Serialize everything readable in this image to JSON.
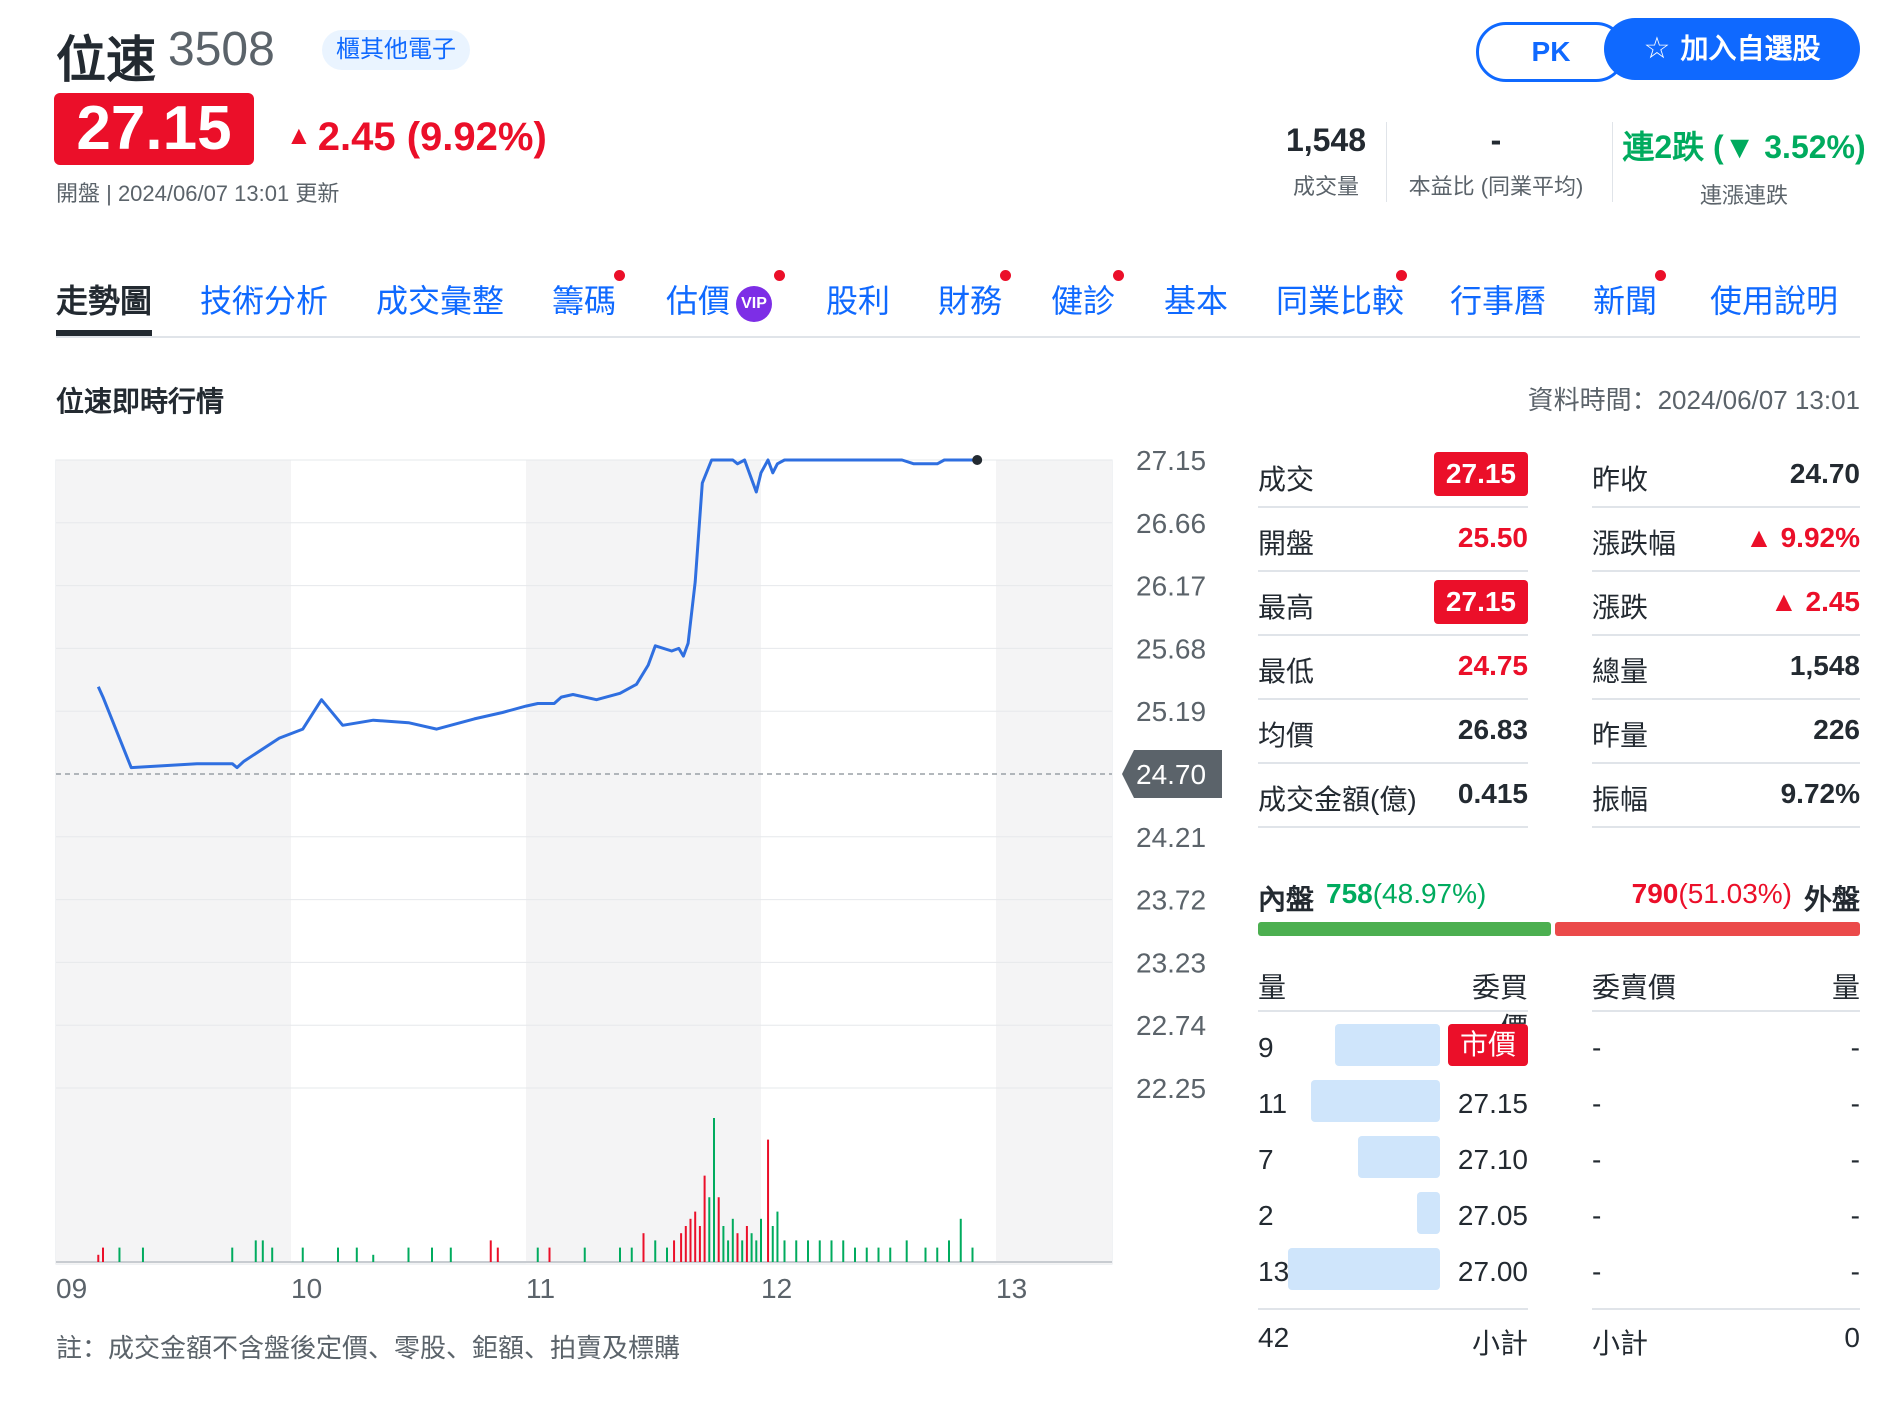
{
  "header": {
    "stock_name": "位速",
    "stock_code": "3508",
    "industry_tag": "櫃其他電子",
    "price": "27.15",
    "change_arrow": "▲",
    "change": "2.45",
    "change_pct": "(9.92%)",
    "update_text": "開盤 | 2024/06/07 13:01 更新",
    "pk_label": "PK",
    "watch_label": "加入自選股",
    "stats": [
      {
        "value": "1,548",
        "label": "成交量"
      },
      {
        "value": "-",
        "label": "本益比 (同業平均)"
      },
      {
        "value": "連2跌 (▼ 3.52%)",
        "label": "連漲連跌"
      }
    ]
  },
  "nav": {
    "items": [
      {
        "label": "走勢圖",
        "active": true,
        "dot": false
      },
      {
        "label": "技術分析",
        "dot": false
      },
      {
        "label": "成交彙整",
        "dot": false
      },
      {
        "label": "籌碼",
        "dot": true
      },
      {
        "label": "估價",
        "dot": true,
        "badge": "VIP"
      },
      {
        "label": "股利",
        "dot": false
      },
      {
        "label": "財務",
        "dot": true
      },
      {
        "label": "健診",
        "dot": true
      },
      {
        "label": "基本",
        "dot": false
      },
      {
        "label": "同業比較",
        "dot": true
      },
      {
        "label": "行事曆",
        "dot": false
      },
      {
        "label": "新聞",
        "dot": true
      },
      {
        "label": "使用說明",
        "dot": false
      }
    ]
  },
  "section": {
    "title": "位速即時行情",
    "data_time": "資料時間：2024/06/07 13:01"
  },
  "colors": {
    "up": "#eb0f29",
    "down": "#00ab5e",
    "line": "#2f6fe0",
    "accent": "#0f69ff"
  },
  "chart_data": {
    "type": "line",
    "x_ticks": [
      "09",
      "10",
      "11",
      "12",
      "13"
    ],
    "y_ticks": [
      "27.15",
      "26.66",
      "26.17",
      "25.68",
      "25.19",
      "24.70",
      "24.21",
      "23.72",
      "23.23",
      "22.74",
      "22.25"
    ],
    "reference_price": "24.70",
    "ylim": [
      22.25,
      27.15
    ],
    "price_series": [
      [
        0.18,
        25.38
      ],
      [
        0.2,
        25.3
      ],
      [
        0.32,
        24.75
      ],
      [
        0.6,
        24.78
      ],
      [
        0.75,
        24.78
      ],
      [
        0.77,
        24.75
      ],
      [
        0.8,
        24.8
      ],
      [
        0.95,
        24.98
      ],
      [
        1.05,
        25.05
      ],
      [
        1.13,
        25.28
      ],
      [
        1.22,
        25.08
      ],
      [
        1.35,
        25.12
      ],
      [
        1.5,
        25.1
      ],
      [
        1.62,
        25.05
      ],
      [
        1.78,
        25.13
      ],
      [
        1.9,
        25.18
      ],
      [
        2.0,
        25.23
      ],
      [
        2.05,
        25.25
      ],
      [
        2.12,
        25.25
      ],
      [
        2.15,
        25.3
      ],
      [
        2.2,
        25.32
      ],
      [
        2.3,
        25.28
      ],
      [
        2.4,
        25.33
      ],
      [
        2.47,
        25.4
      ],
      [
        2.52,
        25.55
      ],
      [
        2.55,
        25.7
      ],
      [
        2.62,
        25.66
      ],
      [
        2.65,
        25.68
      ],
      [
        2.67,
        25.62
      ],
      [
        2.69,
        25.72
      ],
      [
        2.72,
        26.2
      ],
      [
        2.75,
        26.97
      ],
      [
        2.79,
        27.15
      ],
      [
        2.88,
        27.15
      ],
      [
        2.9,
        27.12
      ],
      [
        2.93,
        27.15
      ],
      [
        2.96,
        27.0
      ],
      [
        2.98,
        26.9
      ],
      [
        3.0,
        27.05
      ],
      [
        3.03,
        27.15
      ],
      [
        3.05,
        27.05
      ],
      [
        3.07,
        27.12
      ],
      [
        3.1,
        27.15
      ],
      [
        3.6,
        27.15
      ],
      [
        3.65,
        27.12
      ],
      [
        3.75,
        27.12
      ],
      [
        3.78,
        27.15
      ],
      [
        3.92,
        27.15
      ]
    ],
    "volume_bars": [
      [
        0.18,
        1,
        "up"
      ],
      [
        0.2,
        2,
        "up"
      ],
      [
        0.27,
        2,
        "down"
      ],
      [
        0.37,
        2,
        "down"
      ],
      [
        0.75,
        2,
        "down"
      ],
      [
        0.85,
        3,
        "down"
      ],
      [
        0.88,
        3,
        "down"
      ],
      [
        0.92,
        2,
        "down"
      ],
      [
        1.05,
        2,
        "down"
      ],
      [
        1.2,
        2,
        "down"
      ],
      [
        1.28,
        2,
        "down"
      ],
      [
        1.35,
        1,
        "down"
      ],
      [
        1.5,
        2,
        "down"
      ],
      [
        1.6,
        2,
        "down"
      ],
      [
        1.68,
        2,
        "down"
      ],
      [
        1.85,
        3,
        "up"
      ],
      [
        1.88,
        2,
        "up"
      ],
      [
        2.05,
        2,
        "down"
      ],
      [
        2.1,
        2,
        "up"
      ],
      [
        2.25,
        2,
        "down"
      ],
      [
        2.4,
        2,
        "down"
      ],
      [
        2.45,
        2,
        "down"
      ],
      [
        2.5,
        4,
        "up"
      ],
      [
        2.55,
        3,
        "down"
      ],
      [
        2.6,
        2,
        "down"
      ],
      [
        2.63,
        3,
        "up"
      ],
      [
        2.66,
        4,
        "up"
      ],
      [
        2.68,
        5,
        "up"
      ],
      [
        2.7,
        6,
        "up"
      ],
      [
        2.72,
        7,
        "up"
      ],
      [
        2.74,
        5,
        "up"
      ],
      [
        2.76,
        12,
        "up"
      ],
      [
        2.78,
        9,
        "down"
      ],
      [
        2.8,
        20,
        "down"
      ],
      [
        2.82,
        9,
        "up"
      ],
      [
        2.84,
        5,
        "down"
      ],
      [
        2.86,
        3,
        "down"
      ],
      [
        2.88,
        6,
        "down"
      ],
      [
        2.9,
        4,
        "up"
      ],
      [
        2.92,
        3,
        "down"
      ],
      [
        2.94,
        5,
        "up"
      ],
      [
        2.96,
        4,
        "down"
      ],
      [
        2.98,
        3,
        "down"
      ],
      [
        3.0,
        6,
        "down"
      ],
      [
        3.03,
        17,
        "up"
      ],
      [
        3.05,
        5,
        "down"
      ],
      [
        3.07,
        7,
        "down"
      ],
      [
        3.1,
        3,
        "down"
      ],
      [
        3.15,
        3,
        "down"
      ],
      [
        3.2,
        3,
        "down"
      ],
      [
        3.25,
        3,
        "down"
      ],
      [
        3.3,
        3,
        "down"
      ],
      [
        3.35,
        3,
        "down"
      ],
      [
        3.4,
        2,
        "down"
      ],
      [
        3.45,
        2,
        "down"
      ],
      [
        3.5,
        2,
        "down"
      ],
      [
        3.55,
        2,
        "down"
      ],
      [
        3.62,
        3,
        "down"
      ],
      [
        3.7,
        2,
        "down"
      ],
      [
        3.75,
        2,
        "down"
      ],
      [
        3.8,
        3,
        "down"
      ],
      [
        3.85,
        6,
        "down"
      ],
      [
        3.9,
        2,
        "down"
      ]
    ]
  },
  "quote": {
    "rows": [
      {
        "l1": "成交",
        "v1": "27.15",
        "c1": "chip",
        "l2": "昨收",
        "v2": "24.70",
        "c2": "dark"
      },
      {
        "l1": "開盤",
        "v1": "25.50",
        "c1": "red",
        "l2": "漲跌幅",
        "v2": "▲ 9.92%",
        "c2": "red"
      },
      {
        "l1": "最高",
        "v1": "27.15",
        "c1": "chip",
        "l2": "漲跌",
        "v2": "▲ 2.45",
        "c2": "red"
      },
      {
        "l1": "最低",
        "v1": "24.75",
        "c1": "red",
        "l2": "總量",
        "v2": "1,548",
        "c2": "dark"
      },
      {
        "l1": "均價",
        "v1": "26.83",
        "c1": "dark",
        "l2": "昨量",
        "v2": "226",
        "c2": "dark"
      },
      {
        "l1": "成交金額(億)",
        "v1": "0.415",
        "c1": "dark",
        "l2": "振幅",
        "v2": "9.72%",
        "c2": "dark"
      }
    ]
  },
  "inout": {
    "inner_label": "內盤",
    "inner_value": "758",
    "inner_pct": "(48.97%)",
    "outer_value": "790",
    "outer_pct": "(51.03%)",
    "outer_label": "外盤",
    "inner_ratio": 0.4897
  },
  "orderbook": {
    "headers": {
      "buy_qty": "量",
      "buy_price": "委買價",
      "sell_price": "委賣價",
      "sell_qty": "量"
    },
    "bids": [
      {
        "qty": "9",
        "price": "市價",
        "market": true,
        "ratio": 0.69
      },
      {
        "qty": "11",
        "price": "27.15",
        "ratio": 0.85
      },
      {
        "qty": "7",
        "price": "27.10",
        "ratio": 0.54
      },
      {
        "qty": "2",
        "price": "27.05",
        "ratio": 0.15
      },
      {
        "qty": "13",
        "price": "27.00",
        "ratio": 1.0
      }
    ],
    "asks": [
      {
        "price": "-",
        "qty": "-"
      },
      {
        "price": "-",
        "qty": "-"
      },
      {
        "price": "-",
        "qty": "-"
      },
      {
        "price": "-",
        "qty": "-"
      },
      {
        "price": "-",
        "qty": "-"
      }
    ],
    "buy_total": "42",
    "buy_total_label": "小計",
    "sell_total_label": "小計",
    "sell_total": "0"
  },
  "footnote": "註：成交金額不含盤後定價、零股、鉅額、拍賣及標購"
}
